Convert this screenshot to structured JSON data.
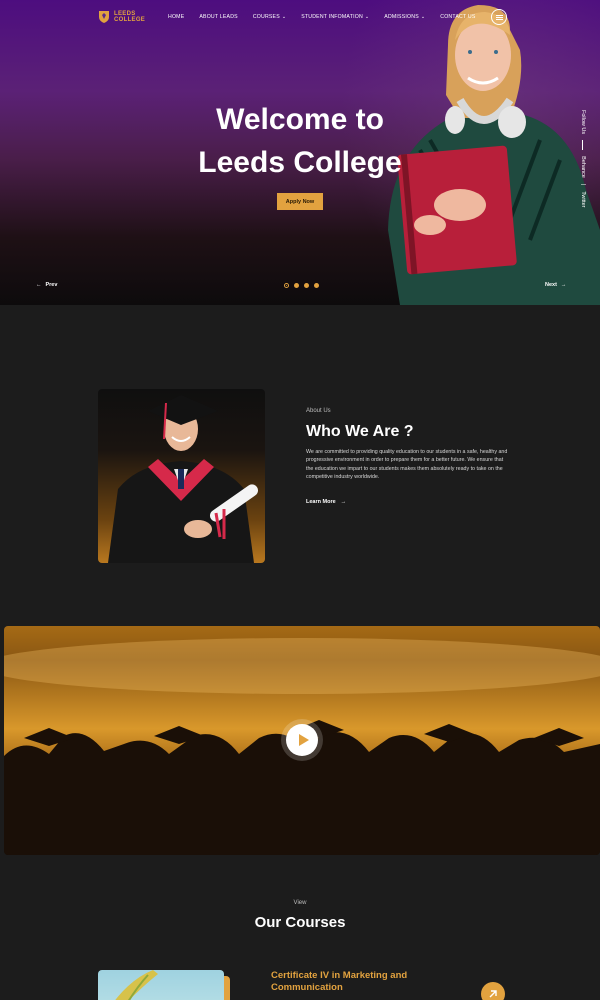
{
  "header": {
    "logo": {
      "line1": "LEEDS",
      "line2": "COLLEGE"
    },
    "nav": [
      {
        "label": "HOME",
        "dropdown": false
      },
      {
        "label": "ABOUT LEADS",
        "dropdown": false
      },
      {
        "label": "COURSES",
        "dropdown": true
      },
      {
        "label": "STUDENT INFOMATION",
        "dropdown": true
      },
      {
        "label": "ADMISSIONS",
        "dropdown": true
      },
      {
        "label": "CONTACT US",
        "dropdown": false
      }
    ],
    "menu_icon": "hamburger-icon"
  },
  "hero": {
    "title_line1": "Welcome to",
    "title_line2": "Leeds College",
    "cta_label": "Apply Now",
    "prev_label": "Prev",
    "next_label": "Next",
    "slides_total": 4,
    "active_slide": 1,
    "social": {
      "follow_label": "Follow Us",
      "links": [
        "Behance",
        "Twitter"
      ]
    }
  },
  "about": {
    "eyebrow": "About Us",
    "title": "Who We Are ?",
    "text": "We are committed to providing quality education to our students in a safe, healthy and progressive environment in order to prepare them for a better future. We ensure that the education we impart to our students makes them absolutely ready to take on the competitive industry worldwide.",
    "link_label": "Learn More"
  },
  "video": {
    "play_icon": "play-icon"
  },
  "courses": {
    "eyebrow": "View",
    "title": "Our Courses",
    "items": [
      {
        "title": "Certificate IV in Marketing and Communication"
      }
    ]
  },
  "colors": {
    "accent": "#e2a23f",
    "background": "#1c1c1c",
    "hero_top": "#4d0d7f"
  }
}
